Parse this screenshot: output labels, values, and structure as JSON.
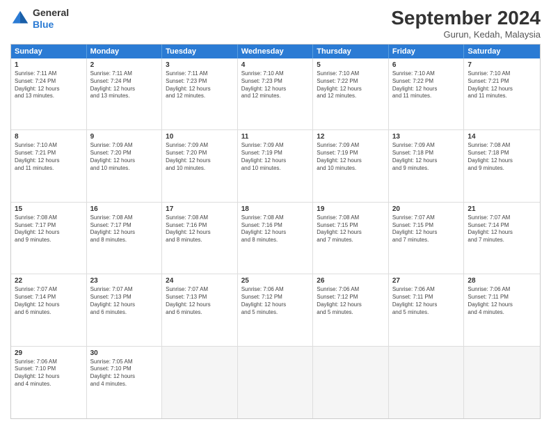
{
  "header": {
    "logo_line1": "General",
    "logo_line2": "Blue",
    "month_title": "September 2024",
    "location": "Gurun, Kedah, Malaysia"
  },
  "days_of_week": [
    "Sunday",
    "Monday",
    "Tuesday",
    "Wednesday",
    "Thursday",
    "Friday",
    "Saturday"
  ],
  "weeks": [
    [
      {
        "num": "1",
        "lines": [
          "Sunrise: 7:11 AM",
          "Sunset: 7:24 PM",
          "Daylight: 12 hours",
          "and 13 minutes."
        ]
      },
      {
        "num": "2",
        "lines": [
          "Sunrise: 7:11 AM",
          "Sunset: 7:24 PM",
          "Daylight: 12 hours",
          "and 13 minutes."
        ]
      },
      {
        "num": "3",
        "lines": [
          "Sunrise: 7:11 AM",
          "Sunset: 7:23 PM",
          "Daylight: 12 hours",
          "and 12 minutes."
        ]
      },
      {
        "num": "4",
        "lines": [
          "Sunrise: 7:10 AM",
          "Sunset: 7:23 PM",
          "Daylight: 12 hours",
          "and 12 minutes."
        ]
      },
      {
        "num": "5",
        "lines": [
          "Sunrise: 7:10 AM",
          "Sunset: 7:22 PM",
          "Daylight: 12 hours",
          "and 12 minutes."
        ]
      },
      {
        "num": "6",
        "lines": [
          "Sunrise: 7:10 AM",
          "Sunset: 7:22 PM",
          "Daylight: 12 hours",
          "and 11 minutes."
        ]
      },
      {
        "num": "7",
        "lines": [
          "Sunrise: 7:10 AM",
          "Sunset: 7:21 PM",
          "Daylight: 12 hours",
          "and 11 minutes."
        ]
      }
    ],
    [
      {
        "num": "8",
        "lines": [
          "Sunrise: 7:10 AM",
          "Sunset: 7:21 PM",
          "Daylight: 12 hours",
          "and 11 minutes."
        ]
      },
      {
        "num": "9",
        "lines": [
          "Sunrise: 7:09 AM",
          "Sunset: 7:20 PM",
          "Daylight: 12 hours",
          "and 10 minutes."
        ]
      },
      {
        "num": "10",
        "lines": [
          "Sunrise: 7:09 AM",
          "Sunset: 7:20 PM",
          "Daylight: 12 hours",
          "and 10 minutes."
        ]
      },
      {
        "num": "11",
        "lines": [
          "Sunrise: 7:09 AM",
          "Sunset: 7:19 PM",
          "Daylight: 12 hours",
          "and 10 minutes."
        ]
      },
      {
        "num": "12",
        "lines": [
          "Sunrise: 7:09 AM",
          "Sunset: 7:19 PM",
          "Daylight: 12 hours",
          "and 10 minutes."
        ]
      },
      {
        "num": "13",
        "lines": [
          "Sunrise: 7:09 AM",
          "Sunset: 7:18 PM",
          "Daylight: 12 hours",
          "and 9 minutes."
        ]
      },
      {
        "num": "14",
        "lines": [
          "Sunrise: 7:08 AM",
          "Sunset: 7:18 PM",
          "Daylight: 12 hours",
          "and 9 minutes."
        ]
      }
    ],
    [
      {
        "num": "15",
        "lines": [
          "Sunrise: 7:08 AM",
          "Sunset: 7:17 PM",
          "Daylight: 12 hours",
          "and 9 minutes."
        ]
      },
      {
        "num": "16",
        "lines": [
          "Sunrise: 7:08 AM",
          "Sunset: 7:17 PM",
          "Daylight: 12 hours",
          "and 8 minutes."
        ]
      },
      {
        "num": "17",
        "lines": [
          "Sunrise: 7:08 AM",
          "Sunset: 7:16 PM",
          "Daylight: 12 hours",
          "and 8 minutes."
        ]
      },
      {
        "num": "18",
        "lines": [
          "Sunrise: 7:08 AM",
          "Sunset: 7:16 PM",
          "Daylight: 12 hours",
          "and 8 minutes."
        ]
      },
      {
        "num": "19",
        "lines": [
          "Sunrise: 7:08 AM",
          "Sunset: 7:15 PM",
          "Daylight: 12 hours",
          "and 7 minutes."
        ]
      },
      {
        "num": "20",
        "lines": [
          "Sunrise: 7:07 AM",
          "Sunset: 7:15 PM",
          "Daylight: 12 hours",
          "and 7 minutes."
        ]
      },
      {
        "num": "21",
        "lines": [
          "Sunrise: 7:07 AM",
          "Sunset: 7:14 PM",
          "Daylight: 12 hours",
          "and 7 minutes."
        ]
      }
    ],
    [
      {
        "num": "22",
        "lines": [
          "Sunrise: 7:07 AM",
          "Sunset: 7:14 PM",
          "Daylight: 12 hours",
          "and 6 minutes."
        ]
      },
      {
        "num": "23",
        "lines": [
          "Sunrise: 7:07 AM",
          "Sunset: 7:13 PM",
          "Daylight: 12 hours",
          "and 6 minutes."
        ]
      },
      {
        "num": "24",
        "lines": [
          "Sunrise: 7:07 AM",
          "Sunset: 7:13 PM",
          "Daylight: 12 hours",
          "and 6 minutes."
        ]
      },
      {
        "num": "25",
        "lines": [
          "Sunrise: 7:06 AM",
          "Sunset: 7:12 PM",
          "Daylight: 12 hours",
          "and 5 minutes."
        ]
      },
      {
        "num": "26",
        "lines": [
          "Sunrise: 7:06 AM",
          "Sunset: 7:12 PM",
          "Daylight: 12 hours",
          "and 5 minutes."
        ]
      },
      {
        "num": "27",
        "lines": [
          "Sunrise: 7:06 AM",
          "Sunset: 7:11 PM",
          "Daylight: 12 hours",
          "and 5 minutes."
        ]
      },
      {
        "num": "28",
        "lines": [
          "Sunrise: 7:06 AM",
          "Sunset: 7:11 PM",
          "Daylight: 12 hours",
          "and 4 minutes."
        ]
      }
    ],
    [
      {
        "num": "29",
        "lines": [
          "Sunrise: 7:06 AM",
          "Sunset: 7:10 PM",
          "Daylight: 12 hours",
          "and 4 minutes."
        ]
      },
      {
        "num": "30",
        "lines": [
          "Sunrise: 7:05 AM",
          "Sunset: 7:10 PM",
          "Daylight: 12 hours",
          "and 4 minutes."
        ]
      },
      {
        "num": "",
        "lines": []
      },
      {
        "num": "",
        "lines": []
      },
      {
        "num": "",
        "lines": []
      },
      {
        "num": "",
        "lines": []
      },
      {
        "num": "",
        "lines": []
      }
    ]
  ]
}
